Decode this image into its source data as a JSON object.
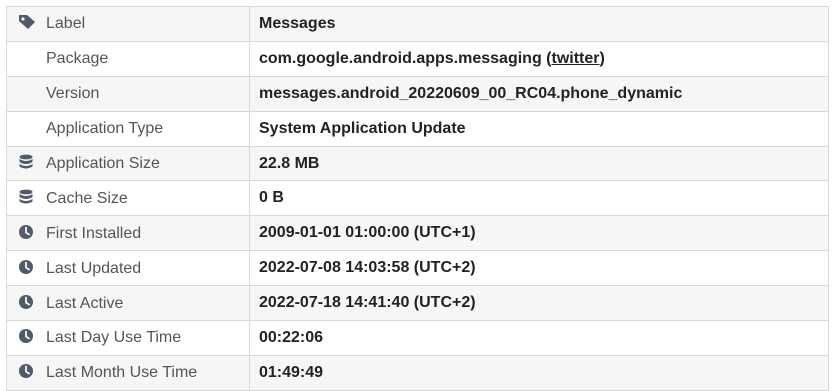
{
  "rows": [
    {
      "label": "Label",
      "value": "Messages",
      "icon": "tag-icon"
    },
    {
      "label": "Package",
      "value": "com.google.android.apps.messaging",
      "link_text": "twitter",
      "icon": ""
    },
    {
      "label": "Version",
      "value": "messages.android_20220609_00_RC04.phone_dynamic",
      "icon": ""
    },
    {
      "label": "Application Type",
      "value": "System Application Update",
      "icon": ""
    },
    {
      "label": "Application Size",
      "value": "22.8 MB",
      "icon": "database-icon"
    },
    {
      "label": "Cache Size",
      "value": "0 B",
      "icon": "database-icon"
    },
    {
      "label": "First Installed",
      "value": "2009-01-01 01:00:00 (UTC+1)",
      "icon": "clock-icon"
    },
    {
      "label": "Last Updated",
      "value": "2022-07-08 14:03:58 (UTC+2)",
      "icon": "clock-icon"
    },
    {
      "label": "Last Active",
      "value": "2022-07-18 14:41:40 (UTC+2)",
      "icon": "clock-icon"
    },
    {
      "label": "Last Day Use Time",
      "value": "00:22:06",
      "icon": "clock-icon"
    },
    {
      "label": "Last Month Use Time",
      "value": "01:49:49",
      "icon": "clock-icon"
    }
  ],
  "icon_color": "#505a6b"
}
